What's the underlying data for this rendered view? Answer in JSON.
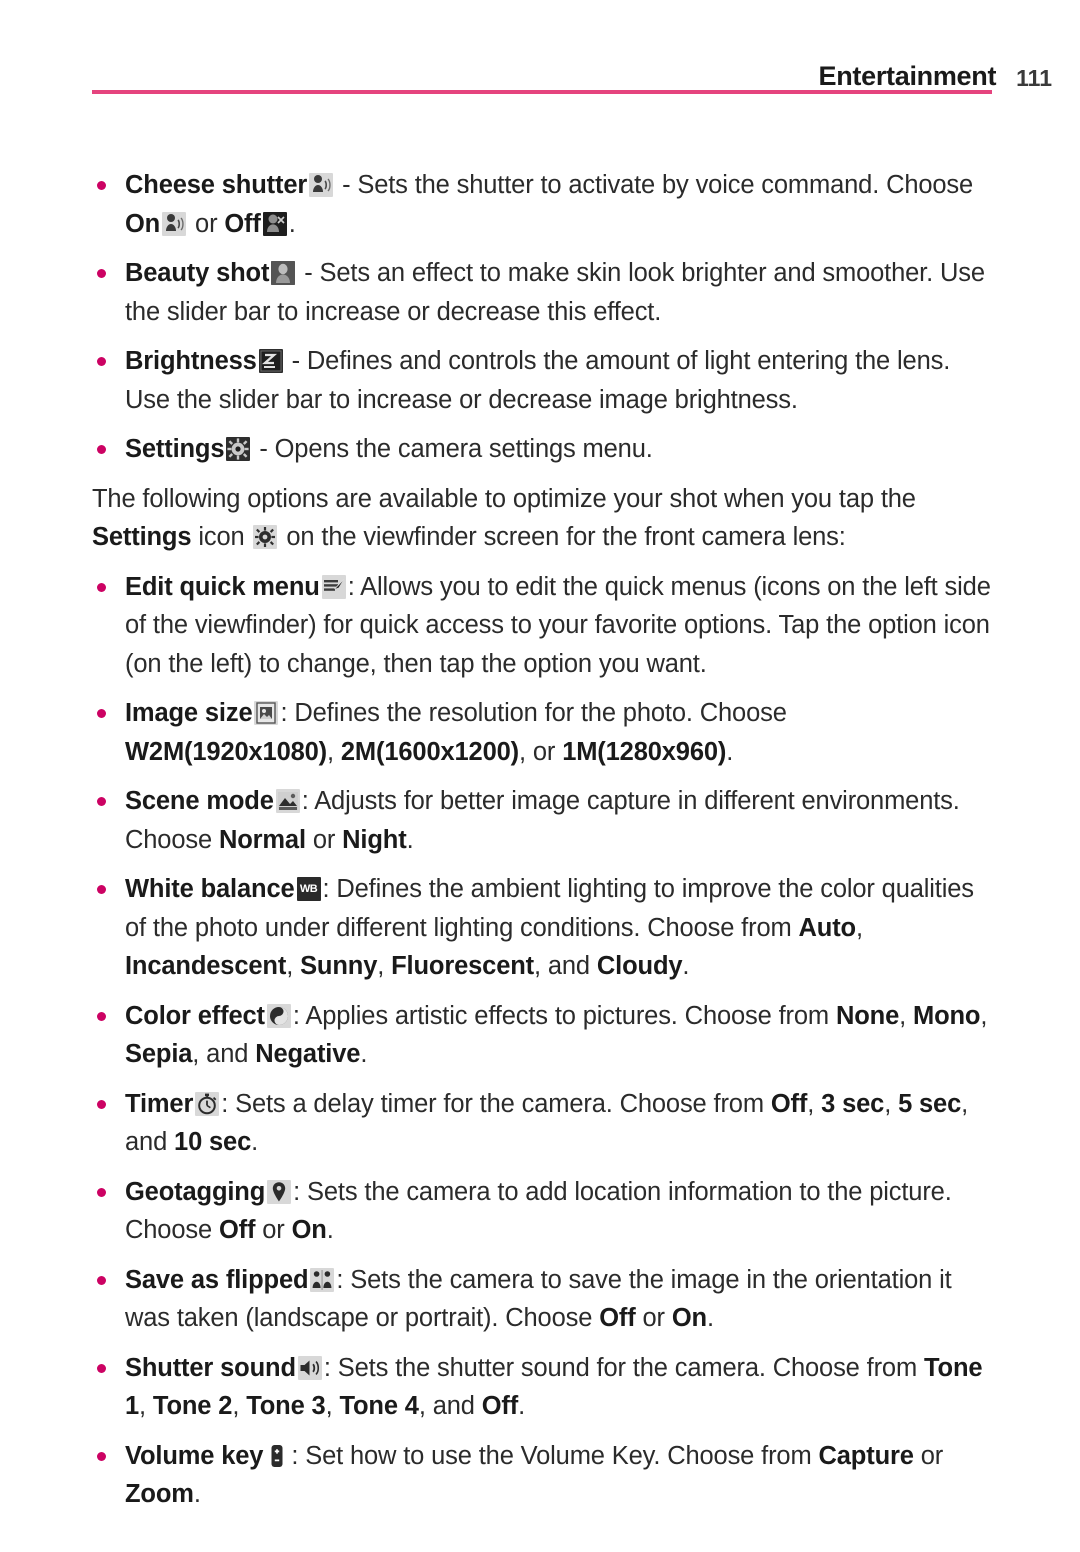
{
  "header": {
    "title": "Entertainment",
    "page_number": "111",
    "rule_color": "#e5447e"
  },
  "theme": {
    "bullet_color": "#cc0263",
    "text_color": "#2b2b2b",
    "background": "#ffffff"
  },
  "body": {
    "bullets_top": [
      {
        "id": "cheese-shutter",
        "term": "Cheese shutter",
        "icon": "voice-head-icon",
        "desc_1": " - Sets the shutter to activate by voice command. Choose ",
        "opt_on": "On",
        "icon_on": "voice-head-on-icon",
        "mid": " or ",
        "opt_off": "Off",
        "icon_off": "voice-head-off-icon",
        "desc_2": "."
      },
      {
        "id": "beauty-shot",
        "term": "Beauty shot",
        "icon": "beauty-face-icon",
        "desc_1": " - Sets an effect to make skin look brighter and smoother. Use the slider bar to increase or decrease this effect."
      },
      {
        "id": "brightness",
        "term": "Brightness",
        "icon": "exposure-icon",
        "desc_1": " - Defines and controls the amount of light entering the lens. Use the slider bar to increase or decrease image brightness."
      },
      {
        "id": "settings",
        "term": "Settings",
        "icon": "gear-icon",
        "desc_1": " - Opens the camera settings menu."
      }
    ],
    "intro_paragraph": {
      "part_1": "The following options are available to optimize your shot when you tap the ",
      "bold_word": "Settings",
      "part_2": " icon ",
      "icon": "gear-icon",
      "part_3": " on the viewfinder screen for the front camera lens:"
    },
    "bullets_bottom": [
      {
        "id": "edit-quick-menu",
        "term": "Edit quick menu",
        "icon": "edit-grid-pencil-icon",
        "desc_1": ": Allows you to edit the quick menus (icons on the left side of the viewfinder) for quick access to your favorite options. Tap the option icon (on the left) to change, then tap the option you want."
      },
      {
        "id": "image-size",
        "term": "Image size",
        "icon": "image-size-icon",
        "desc_1": ": Defines the resolution for the photo. Choose ",
        "options": [
          "W2M(1920x1080)",
          "2M(1600x1200)",
          "1M(1280x960)"
        ],
        "sep_1": ", ",
        "sep_last": ", or ",
        "desc_2": "."
      },
      {
        "id": "scene-mode",
        "term": "Scene mode",
        "icon": "landscape-icon",
        "desc_1": ": Adjusts for better image capture in different environments. Choose ",
        "options": [
          "Normal",
          "Night"
        ],
        "sep_1": " or ",
        "desc_2": "."
      },
      {
        "id": "white-balance",
        "term": "White balance",
        "icon": "wb-icon",
        "desc_1": ": Defines the ambient lighting to improve the color qualities of the photo under different lighting conditions. Choose from ",
        "options": [
          "Auto",
          "Incandescent",
          "Sunny",
          "Fluorescent",
          "Cloudy"
        ],
        "sep_1": ", ",
        "sep_last": ", and ",
        "desc_2": "."
      },
      {
        "id": "color-effect",
        "term": "Color effect",
        "icon": "color-effect-icon",
        "desc_1": ": Applies artistic effects to pictures. Choose from ",
        "options": [
          "None",
          "Mono",
          "Sepia",
          "Negative"
        ],
        "sep_1": ", ",
        "sep_last": ", and ",
        "desc_2": "."
      },
      {
        "id": "timer",
        "term": "Timer",
        "icon": "stopwatch-icon",
        "desc_1": ": Sets a delay timer for the camera. Choose from ",
        "options": [
          "Off",
          "3 sec",
          "5 sec",
          "10 sec"
        ],
        "sep_1": ", ",
        "sep_last": ", and ",
        "desc_2": "."
      },
      {
        "id": "geotagging",
        "term": "Geotagging",
        "icon": "map-pin-icon",
        "desc_1": ": Sets the camera to add location information to the picture. Choose ",
        "options": [
          "Off",
          "On"
        ],
        "sep_1": " or ",
        "desc_2": "."
      },
      {
        "id": "save-as-flipped",
        "term": "Save as flipped",
        "icon": "flip-icon",
        "desc_1": ": Sets the camera to save the image in the orientation it was taken (landscape or portrait). Choose ",
        "options": [
          "Off",
          "On"
        ],
        "sep_1": " or ",
        "desc_2": "."
      },
      {
        "id": "shutter-sound",
        "term": "Shutter sound",
        "icon": "speaker-icon",
        "desc_1": ": Sets the shutter sound for the camera. Choose from ",
        "options": [
          "Tone 1",
          "Tone 2",
          "Tone 3",
          "Tone 4",
          "Off"
        ],
        "sep_1": ", ",
        "sep_last": ", and ",
        "desc_2": "."
      },
      {
        "id": "volume-key",
        "term": "Volume key",
        "icon": "volume-rocker-icon",
        "desc_1": ": Set how to use the Volume Key. Choose from ",
        "options": [
          "Capture",
          "Zoom"
        ],
        "sep_1": " or ",
        "desc_2": "."
      }
    ]
  }
}
